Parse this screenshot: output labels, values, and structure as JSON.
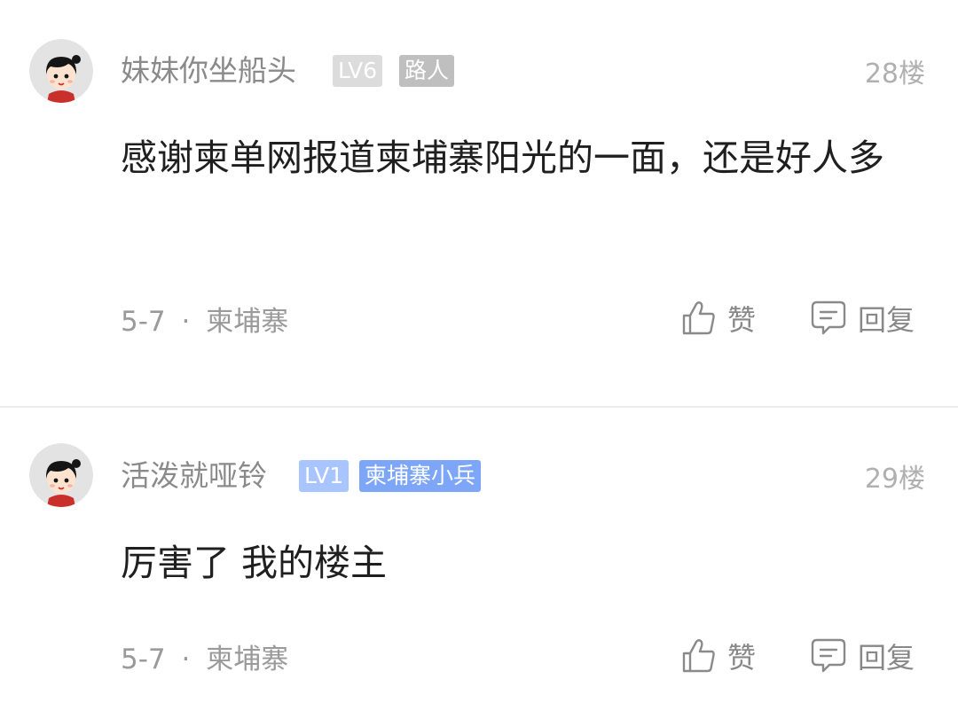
{
  "comments": [
    {
      "username": "妹妹你坐船头",
      "level": "LV6",
      "tag": "路人",
      "floor": "28楼",
      "content": "感谢柬单网报道柬埔寨阳光的一面，还是好人多",
      "date": "5-7",
      "separator": "·",
      "location": "柬埔寨",
      "like_label": "赞",
      "reply_label": "回复",
      "colors": {
        "level_bg": "#dcdcdc",
        "tag_bg": "#bfbfbf"
      }
    },
    {
      "username": "活泼就哑铃",
      "level": "LV1",
      "tag": "柬埔寨小兵",
      "floor": "29楼",
      "content": "厉害了 我的楼主",
      "date": "5-7",
      "separator": "·",
      "location": "柬埔寨",
      "like_label": "赞",
      "reply_label": "回复",
      "colors": {
        "level_bg": "#a9c5ff",
        "tag_bg": "#7ea6f8"
      }
    }
  ],
  "icons": {
    "avatar": "cartoon-girl-avatar",
    "like": "thumbs-up-icon",
    "reply": "comment-bubble-icon"
  }
}
